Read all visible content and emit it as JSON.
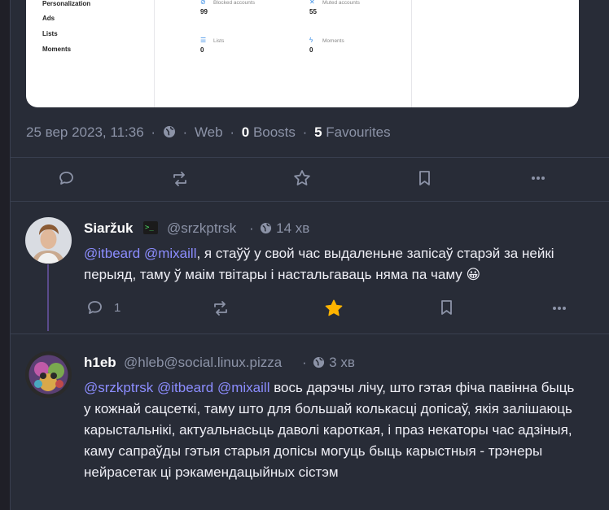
{
  "card": {
    "menu": [
      "Personalization",
      "Ads",
      "Lists",
      "Moments"
    ],
    "stats": [
      {
        "label": "Blocked accounts",
        "value": "99",
        "icon": "block-icon"
      },
      {
        "label": "Muted accounts",
        "value": "55",
        "icon": "mute-icon"
      },
      {
        "label": "Lists",
        "value": "0",
        "icon": "list-icon"
      },
      {
        "label": "Moments",
        "value": "0",
        "icon": "moments-icon"
      }
    ]
  },
  "status": {
    "date": "25 вер 2023, 11:36",
    "visibility_icon": "globe-icon",
    "app": "Web",
    "boosts_count": "0",
    "boosts_label": "Boosts",
    "favs_count": "5",
    "favs_label": "Favourites"
  },
  "post1": {
    "name": "Siaržuk",
    "badge": ">_",
    "handle": "@srzkptrsk",
    "time": "14 хв",
    "m1": "@itbeard",
    "m2": "@mixaill",
    "text": ", я стаўў у свой час выдаленьне запісаў старэй за нейкі перыяд, таму ў маім твітары і настальгаваць няма па чаму",
    "emoji": "😀",
    "reply_count": "1"
  },
  "post2": {
    "name": "h1eb",
    "handle": "@hleb@social.linux.pizza",
    "time": "3 хв",
    "m1": "@srzkptrsk",
    "m2": "@itbeard",
    "m3": "@mixaill",
    "text": " вось дарэчы лічу, што гэтая фіча павінна быць у кожнай сацсеткі, таму што для большай колькасці допісаў, якія залішаюць карыстальнікі, актуальнасьць даволі кароткая, і праз некаторы час адзіныя, каму сапраўды гэтыя старыя допісы могуць быць карыстныя - трэнеры нейрасетак ці рэкамендацыйных сістэм"
  }
}
